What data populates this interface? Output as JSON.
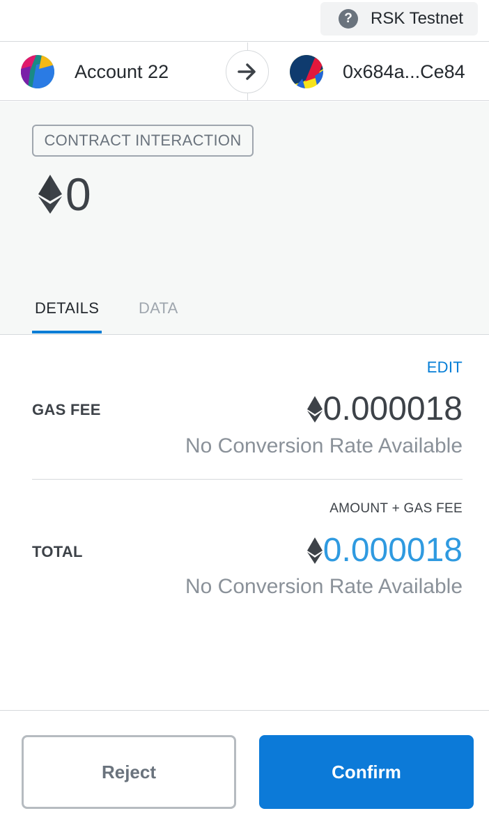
{
  "network": {
    "name": "RSK Testnet",
    "icon": "question-circle-icon"
  },
  "sender": {
    "name": "Account 22",
    "avatar": "jazzicon-avatar"
  },
  "recipient": {
    "name": "0x684a...Ce84",
    "avatar": "jazzicon-avatar"
  },
  "summary": {
    "action": "CONTRACT INTERACTION",
    "amount": "0",
    "currency_icon": "eth-icon"
  },
  "tabs": {
    "details": "DETAILS",
    "data": "DATA",
    "active": "DETAILS"
  },
  "details": {
    "edit_label": "EDIT",
    "gas_fee": {
      "label": "GAS FEE",
      "amount": "0.000018",
      "conversion": "No Conversion Rate Available"
    },
    "total": {
      "label": "TOTAL",
      "subheading": "AMOUNT + GAS FEE",
      "amount": "0.000018",
      "conversion": "No Conversion Rate Available"
    }
  },
  "buttons": {
    "reject": "Reject",
    "confirm": "Confirm"
  },
  "colors": {
    "primary": "#037dd6",
    "confirm_bg": "#0c7ad8",
    "total_amount": "#2f9ae0"
  }
}
